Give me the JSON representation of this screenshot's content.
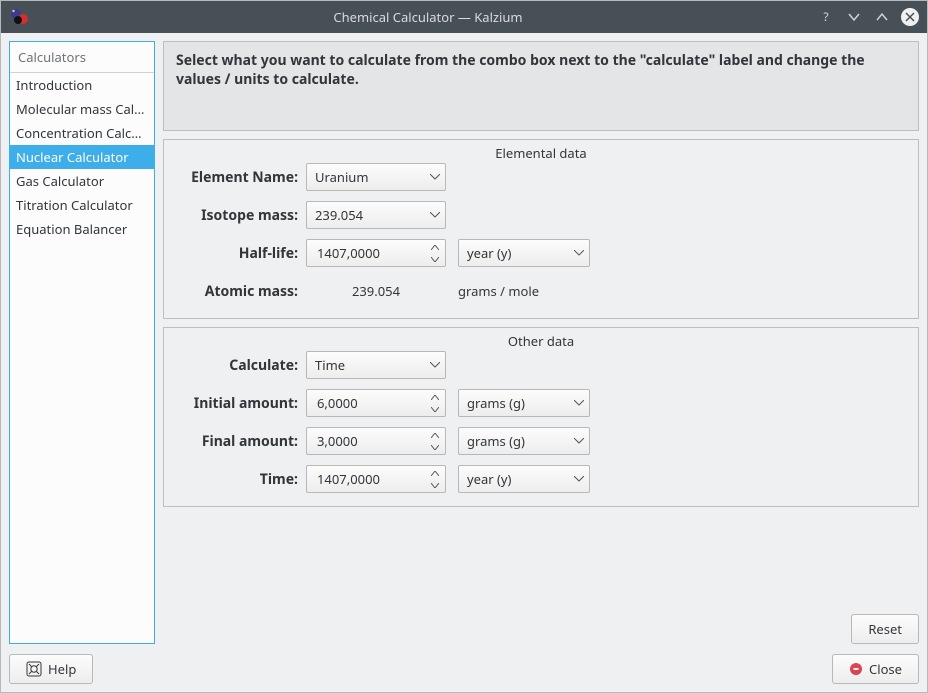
{
  "window": {
    "title": "Chemical Calculator — Kalzium"
  },
  "sidebar": {
    "header": "Calculators",
    "items": [
      {
        "label": "Introduction",
        "selected": false
      },
      {
        "label": "Molecular mass Calc…",
        "selected": false
      },
      {
        "label": "Concentration Calcul…",
        "selected": false
      },
      {
        "label": "Nuclear Calculator",
        "selected": true
      },
      {
        "label": "Gas Calculator",
        "selected": false
      },
      {
        "label": "Titration Calculator",
        "selected": false
      },
      {
        "label": "Equation Balancer",
        "selected": false
      }
    ]
  },
  "instruction": "Select what you want to calculate from the combo box next to the \"calculate\" label and change the values / units to calculate.",
  "elemental": {
    "legend": "Elemental data",
    "element_name_label": "Element Name:",
    "element_name_value": "Uranium",
    "isotope_mass_label": "Isotope mass:",
    "isotope_mass_value": "239.054",
    "half_life_label": "Half-life:",
    "half_life_value": "1407,0000",
    "half_life_unit": "year (y)",
    "atomic_mass_label": "Atomic mass:",
    "atomic_mass_value": "239.054",
    "atomic_mass_unit": "grams / mole"
  },
  "other": {
    "legend": "Other data",
    "calculate_label": "Calculate:",
    "calculate_value": "Time",
    "initial_amount_label": "Initial amount:",
    "initial_amount_value": "6,0000",
    "initial_amount_unit": "grams (g)",
    "final_amount_label": "Final amount:",
    "final_amount_value": "3,0000",
    "final_amount_unit": "grams (g)",
    "time_label": "Time:",
    "time_value": "1407,0000",
    "time_unit": "year (y)"
  },
  "buttons": {
    "reset": "Reset",
    "help": "Help",
    "close": "Close"
  }
}
